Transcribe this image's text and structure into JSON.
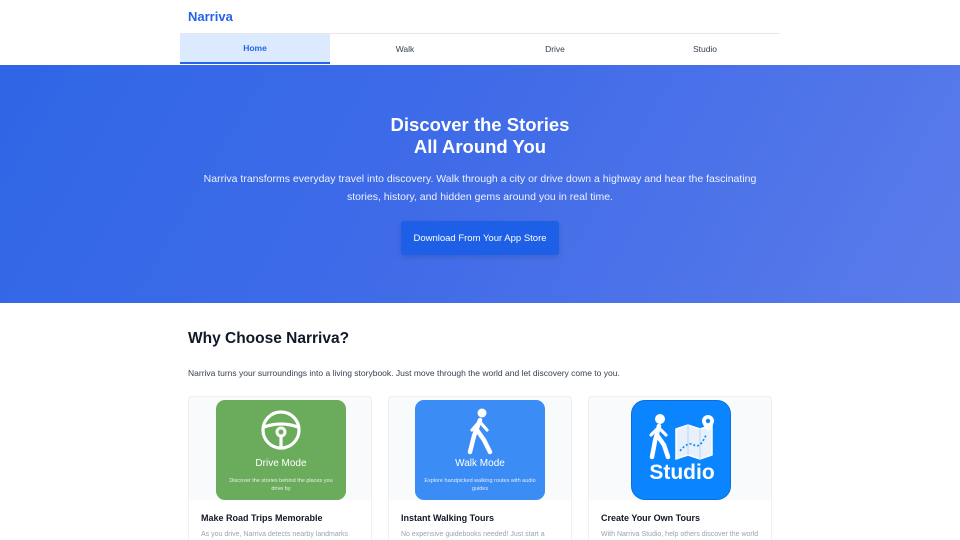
{
  "brand": {
    "name": "Narriva",
    "color": "#2563eb"
  },
  "nav": {
    "tabs": [
      {
        "label": "Home",
        "active": true
      },
      {
        "label": "Walk",
        "active": false
      },
      {
        "label": "Drive",
        "active": false
      },
      {
        "label": "Studio",
        "active": false
      }
    ]
  },
  "hero": {
    "title_line1": "Discover the Stories",
    "title_line2": "All Around You",
    "description": "Narriva transforms everyday travel into discovery. Walk through a city or drive down a highway and hear the fascinating stories, history, and hidden gems around you in real time.",
    "cta_label": "Download From Your App Store"
  },
  "why": {
    "title": "Why Choose Narriva?",
    "description": "Narriva turns your surroundings into a living storybook. Just move through the world and let discovery come to you."
  },
  "cards": [
    {
      "tile_label": "Drive Mode",
      "tile_sub": "Discover the stories behind the places you drive by",
      "tile_icon": "steering-wheel-icon",
      "tile_color": "#6aab5c",
      "title": "Make Road Trips Memorable",
      "text": "As you drive, Narriva detects nearby landmarks"
    },
    {
      "tile_label": "Walk Mode",
      "tile_sub": "Explore handpicked walking routes with audio guides",
      "tile_icon": "walking-person-icon",
      "tile_color": "#3b8cf5",
      "title": "Instant Walking Tours",
      "text": "No expensive guidebooks needed! Just start a"
    },
    {
      "tile_label": "Studio",
      "tile_icon": "map-route-icon",
      "tile_color": "#0a84ff",
      "title": "Create Your Own Tours",
      "text": "With Narriva Studio, help others discover the world"
    }
  ]
}
